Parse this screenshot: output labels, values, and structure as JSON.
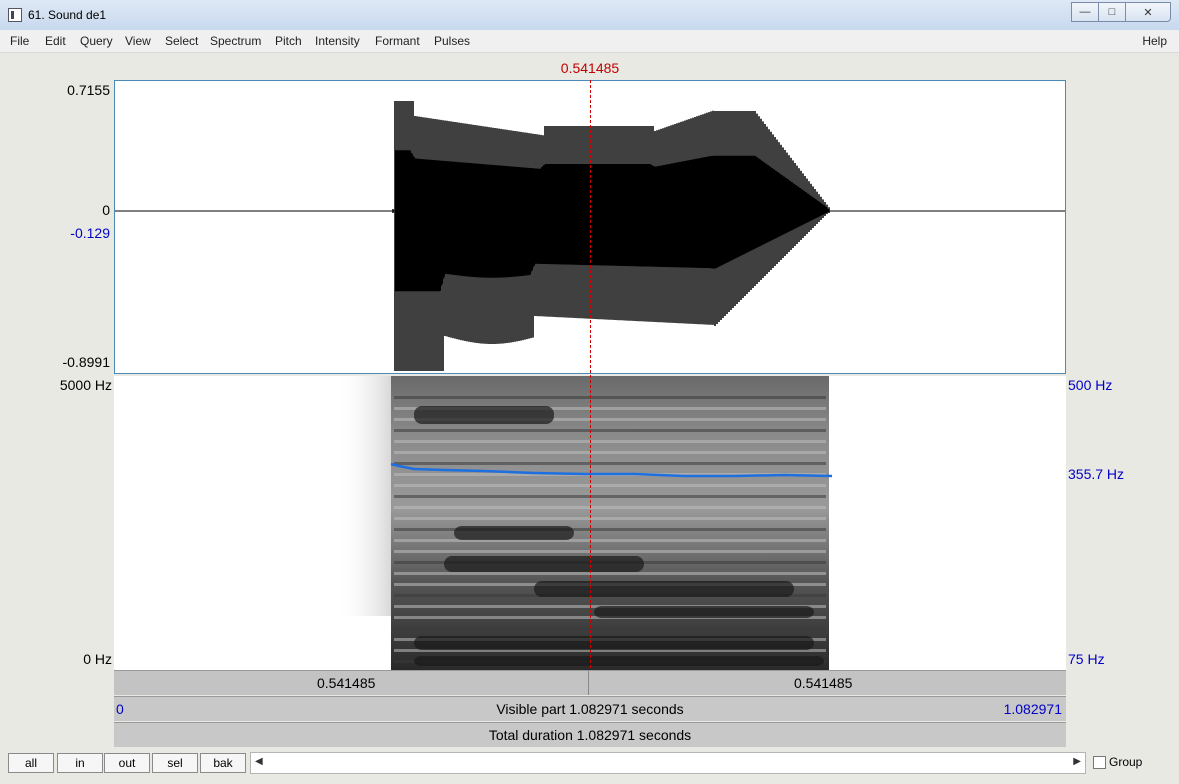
{
  "window": {
    "title": "61. Sound de1"
  },
  "menu": {
    "items": [
      "File",
      "Edit",
      "Query",
      "View",
      "Select",
      "Spectrum",
      "Pitch",
      "Intensity",
      "Formant",
      "Pulses"
    ],
    "help": "Help"
  },
  "cursor": {
    "time_label": "0.541485"
  },
  "waveform": {
    "ymax": "0.7155",
    "zero": "0",
    "cursor_value": "-0.129",
    "ymin": "-0.8991"
  },
  "spectrogram": {
    "fmax": "5000 Hz",
    "fmin": "0 Hz",
    "pitch_max": "500 Hz",
    "pitch_value": "355.7 Hz",
    "pitch_min": "75 Hz"
  },
  "timebar": {
    "left_time": "0.541485",
    "right_time": "0.541485",
    "visible_start": "0",
    "visible_label": "Visible part 1.082971 seconds",
    "visible_end": "1.082971",
    "total_label": "Total duration 1.082971 seconds"
  },
  "buttons": {
    "all": "all",
    "in": "in",
    "out": "out",
    "sel": "sel",
    "bak": "bak"
  },
  "group_label": "Group",
  "colors": {
    "cursor": "#c00000",
    "axis_blue": "#0000c8",
    "pitch": "#1e6fe0"
  }
}
